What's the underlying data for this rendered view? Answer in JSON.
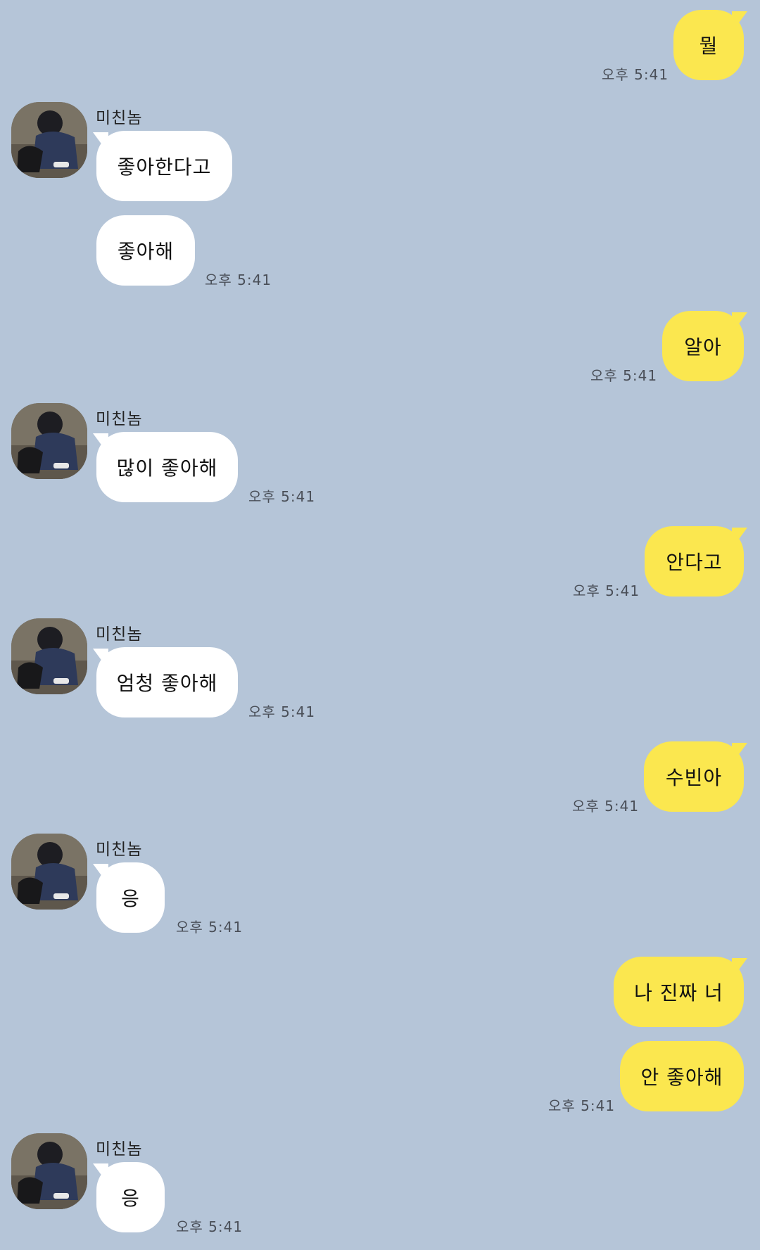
{
  "sender_name": "미친놈",
  "messages": [
    {
      "side": "out",
      "text": "뭘",
      "time": "오후 5:41"
    },
    {
      "side": "in",
      "text": "좋아한다고",
      "time": ""
    },
    {
      "side": "in",
      "text": "좋아해",
      "time": "오후 5:41"
    },
    {
      "side": "out",
      "text": "알아",
      "time": "오후 5:41"
    },
    {
      "side": "in",
      "text": "많이 좋아해",
      "time": "오후 5:41"
    },
    {
      "side": "out",
      "text": "안다고",
      "time": "오후 5:41"
    },
    {
      "side": "in",
      "text": "엄청 좋아해",
      "time": "오후 5:41"
    },
    {
      "side": "out",
      "text": "수빈아",
      "time": "오후 5:41"
    },
    {
      "side": "in",
      "text": "응",
      "time": "오후 5:41"
    },
    {
      "side": "out",
      "text": "나 진짜 너",
      "time": ""
    },
    {
      "side": "out",
      "text": "안 좋아해",
      "time": "오후 5:41"
    },
    {
      "side": "in",
      "text": "응",
      "time": "오후 5:41"
    }
  ],
  "colors": {
    "background": "#b5c5d8",
    "incoming": "#ffffff",
    "outgoing": "#fbe74f"
  }
}
